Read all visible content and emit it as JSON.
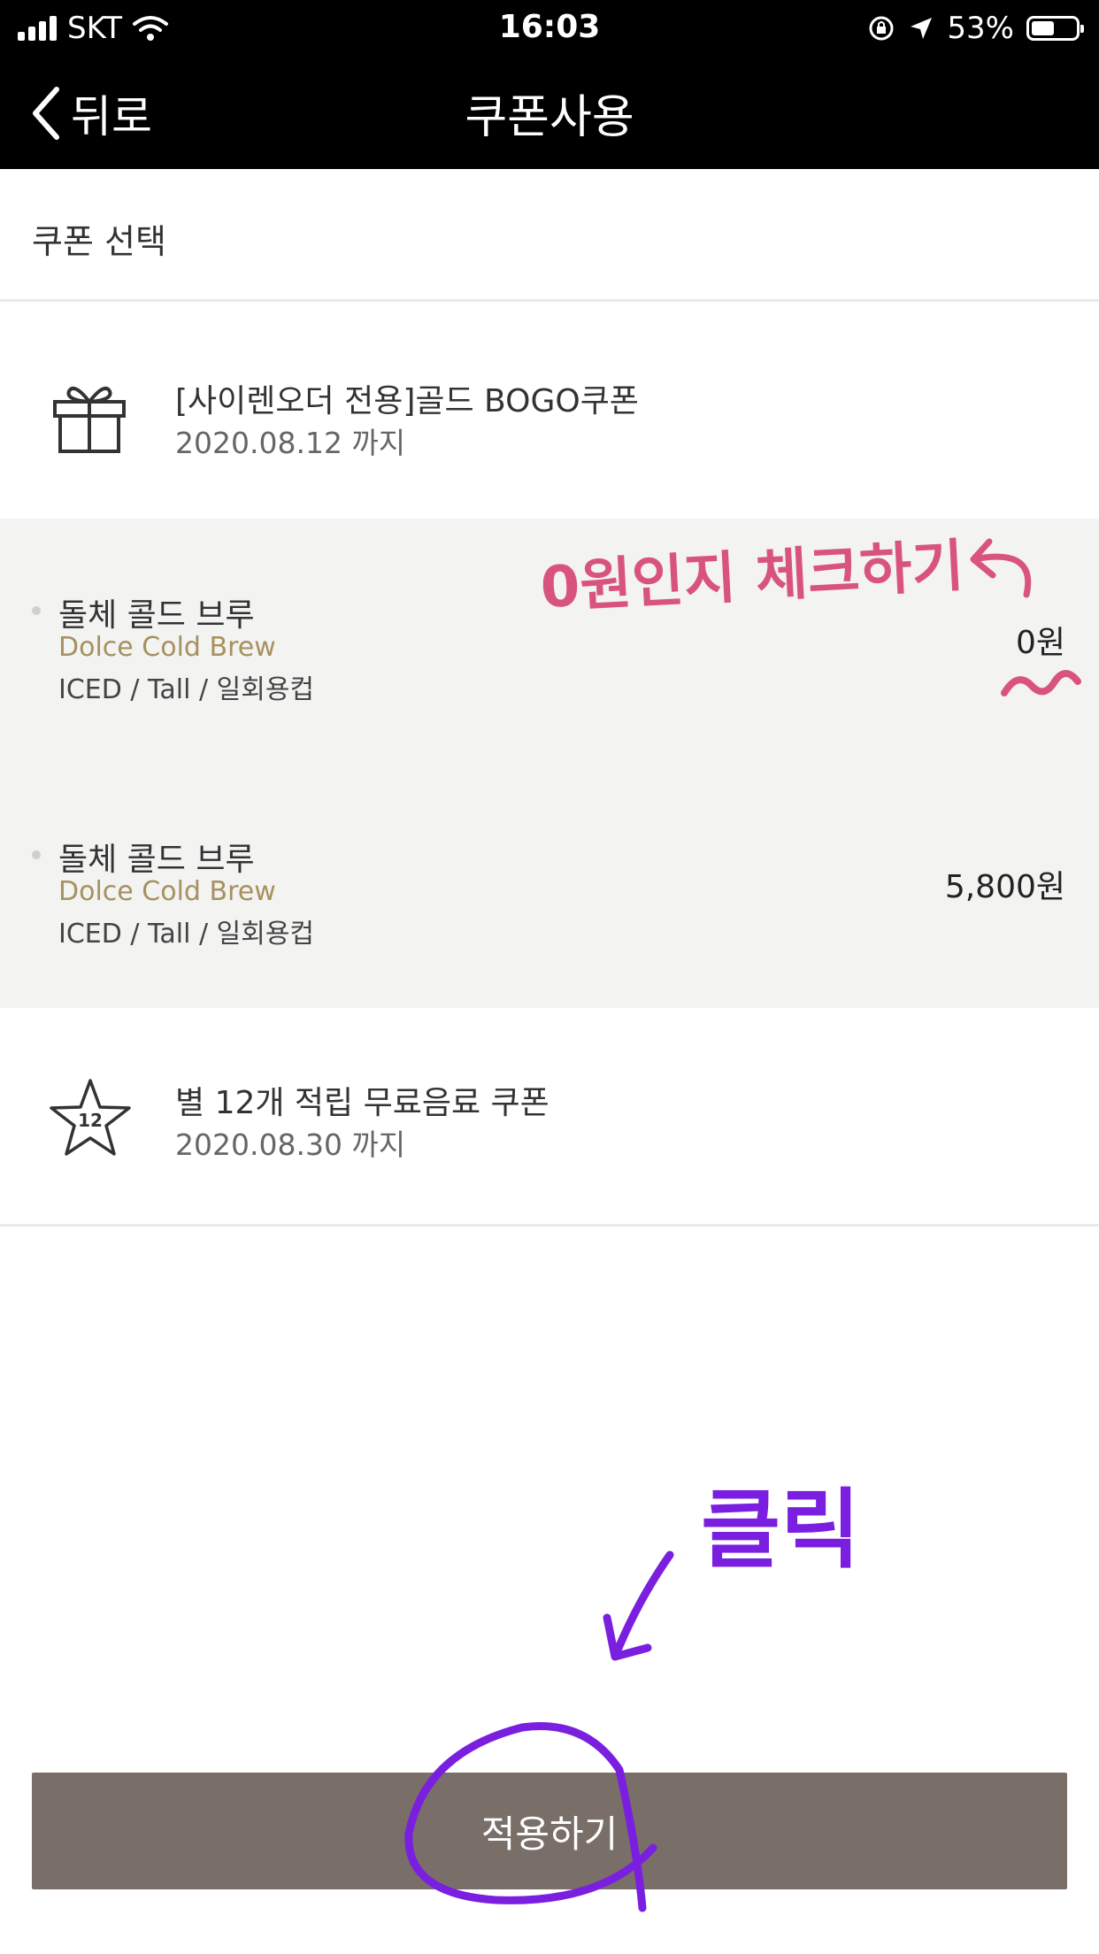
{
  "status_bar": {
    "carrier": "SKT",
    "time": "16:03",
    "battery_percent": "53%",
    "battery_level": 0.53
  },
  "header": {
    "back_label": "뒤로",
    "title": "쿠폰사용"
  },
  "section_title": "쿠폰 선택",
  "coupons": [
    {
      "name": "[사이렌오더 전용]골드 BOGO쿠폰",
      "date": "2020.08.12 까지",
      "icon": "gift-icon"
    },
    {
      "name": "별 12개 적립 무료음료 쿠폰",
      "date": "2020.08.30 까지",
      "icon": "star-12-icon",
      "icon_text": "12"
    }
  ],
  "items": [
    {
      "name_ko": "돌체 콜드 브루",
      "name_en": "Dolce Cold Brew",
      "options": "ICED / Tall / 일회용컵",
      "price": "0원"
    },
    {
      "name_ko": "돌체 콜드 브루",
      "name_en": "Dolce Cold Brew",
      "options": "ICED / Tall / 일회용컵",
      "price": "5,800원"
    }
  ],
  "apply_label": "적용하기",
  "annotations": {
    "check_note": "0원인지 체크하기",
    "click_note": "클릭"
  },
  "colors": {
    "header_bg": "#000000",
    "items_bg": "#f3f3f2",
    "english_name": "#a6915f",
    "apply_button": "#7a6e69",
    "annotation_pink": "#d9547c",
    "annotation_purple": "#7a1fe0"
  }
}
